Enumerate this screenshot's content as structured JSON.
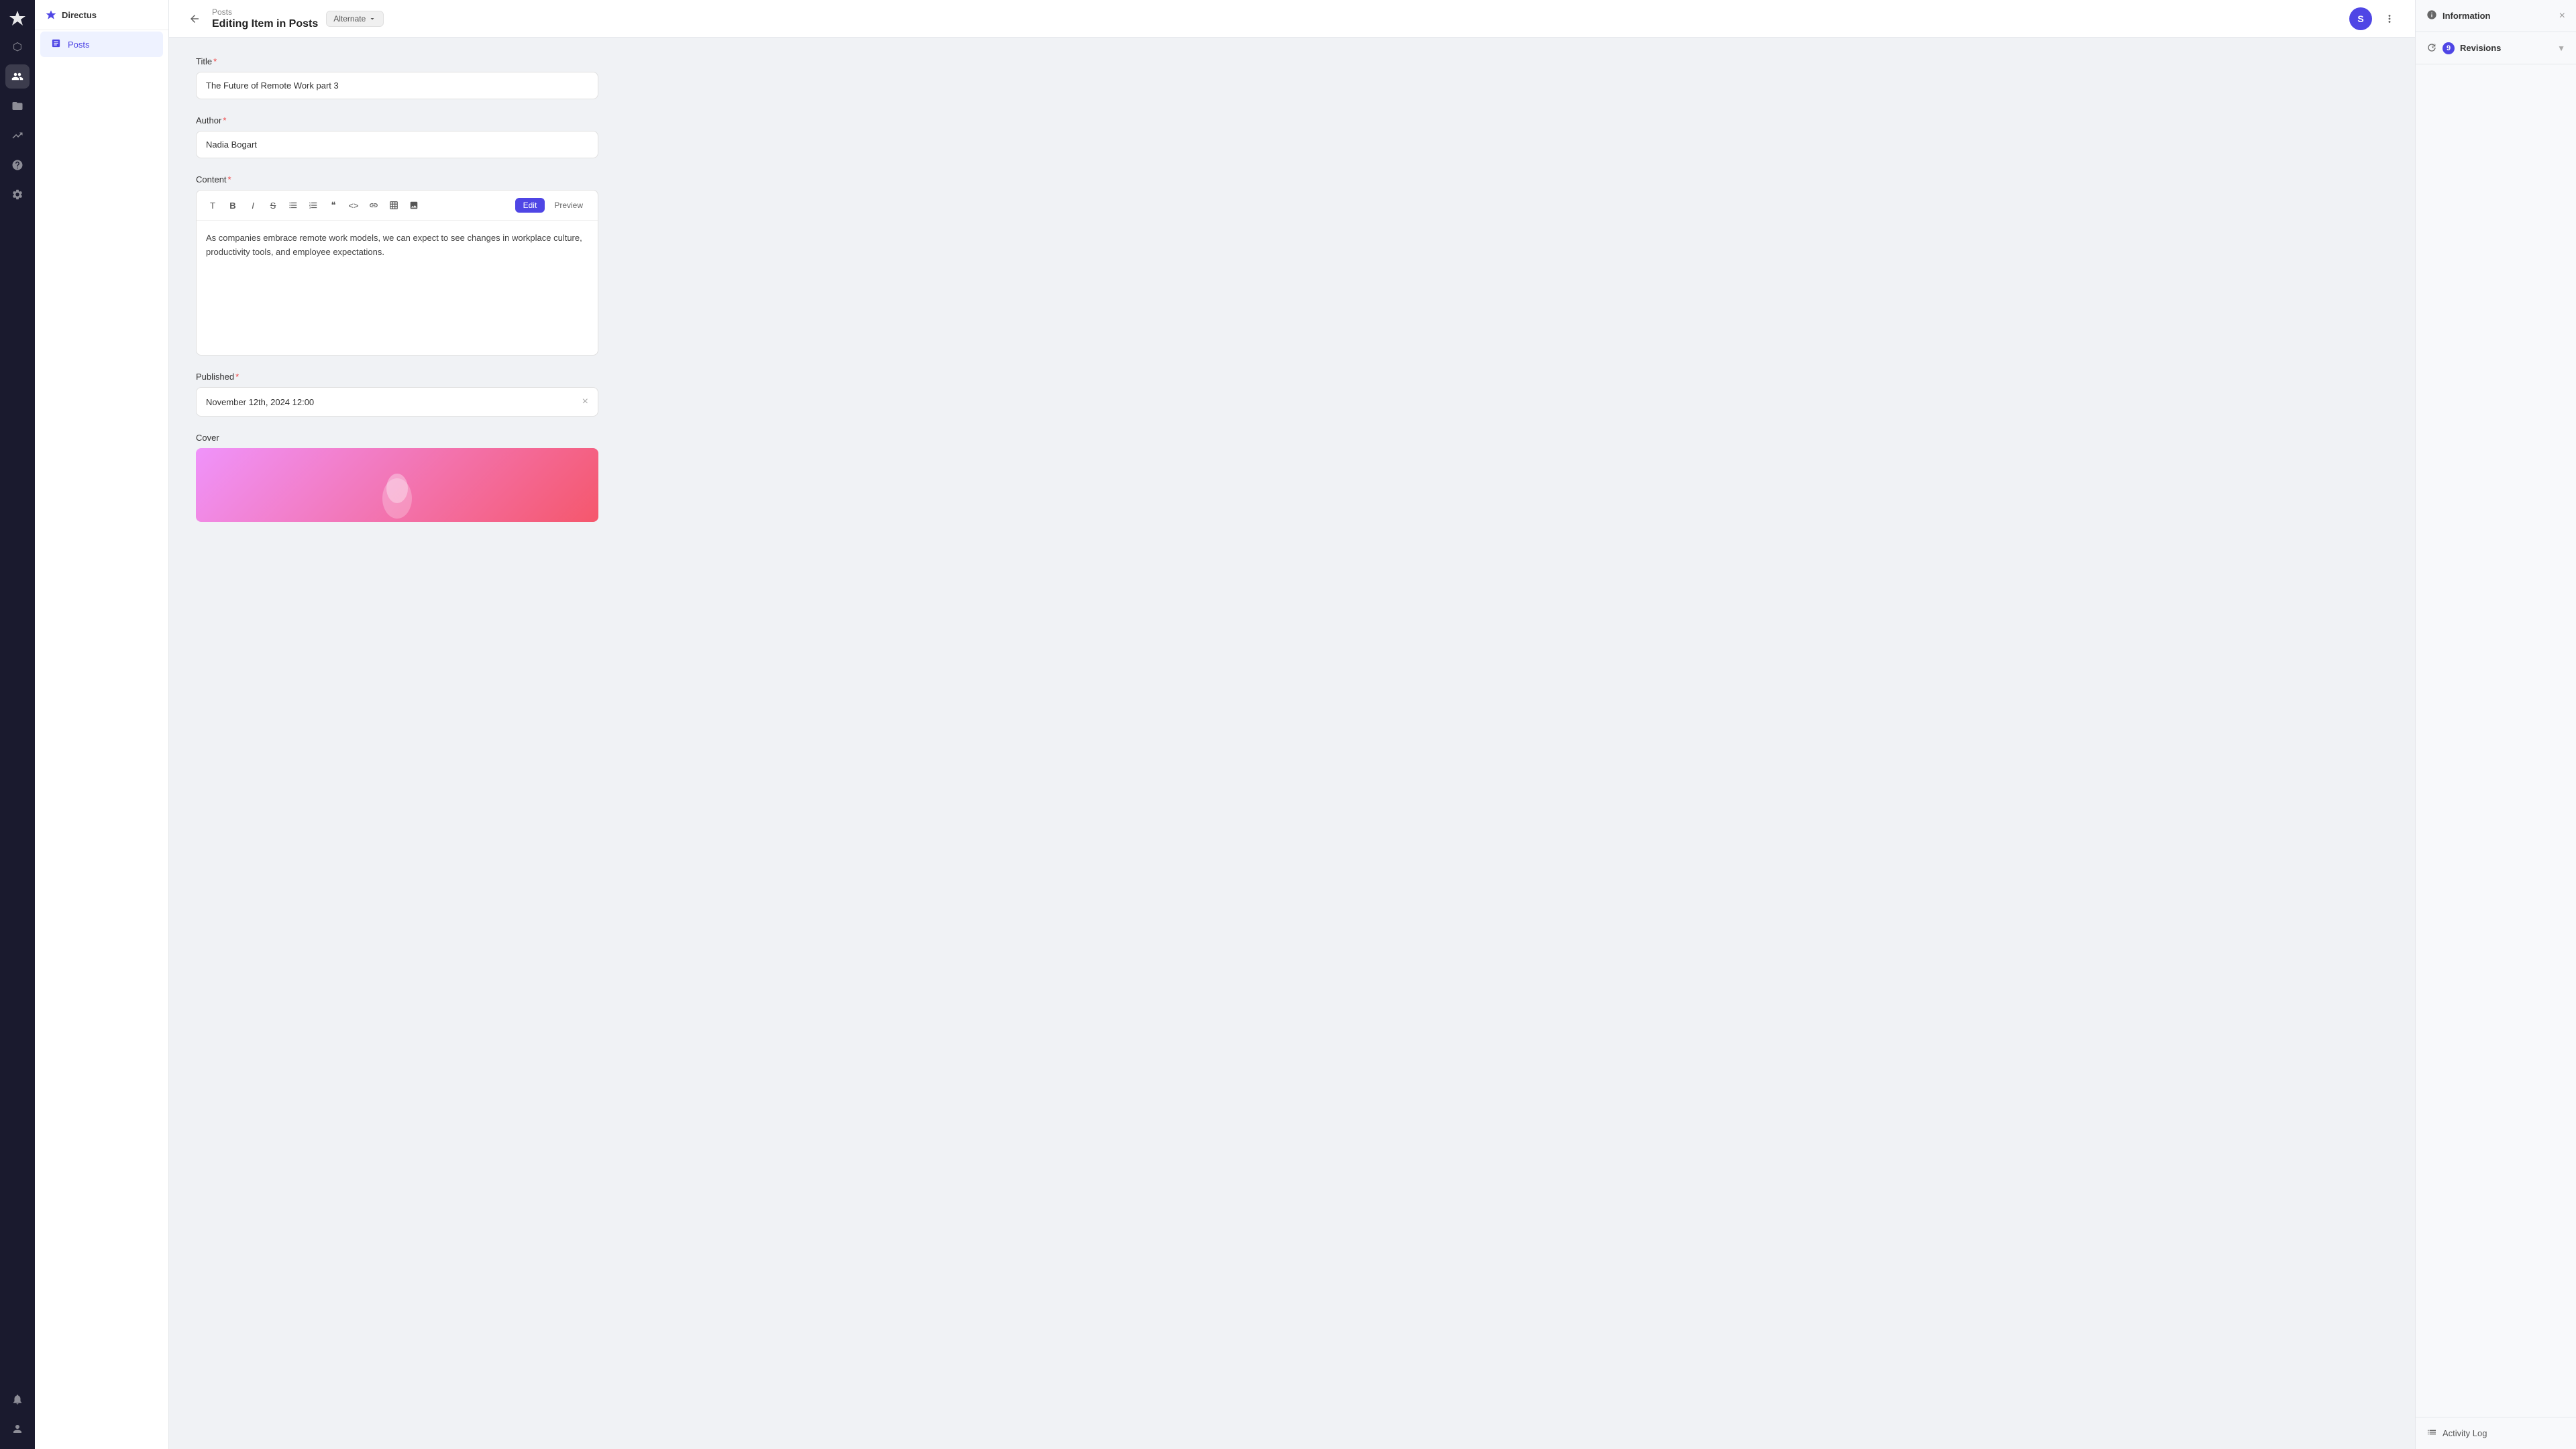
{
  "app": {
    "name": "Directus",
    "logo": "✦"
  },
  "sidebar": {
    "items": [
      {
        "icon": "⬡",
        "label": "Home",
        "active": false
      },
      {
        "icon": "👤",
        "label": "Users",
        "active": false
      },
      {
        "icon": "📁",
        "label": "Files",
        "active": false
      },
      {
        "icon": "📈",
        "label": "Insights",
        "active": false
      },
      {
        "icon": "❓",
        "label": "Help",
        "active": false
      },
      {
        "icon": "⚙",
        "label": "Settings",
        "active": false
      }
    ],
    "bottom_items": [
      {
        "icon": "🔔",
        "label": "Notifications",
        "active": false
      },
      {
        "icon": "👤",
        "label": "Profile",
        "active": false
      }
    ]
  },
  "nav_panel": {
    "title": "Directus",
    "logo": "◆",
    "items": [
      {
        "icon": "📋",
        "label": "Posts",
        "active": true
      }
    ]
  },
  "topbar": {
    "breadcrumb": "Posts",
    "title": "Editing Item in Posts",
    "variant_label": "Alternate",
    "avatar_initials": "S",
    "back_label": "←"
  },
  "form": {
    "title_label": "Title",
    "title_value": "The Future of Remote Work part 3",
    "author_label": "Author",
    "author_value": "Nadia Bogart",
    "content_label": "Content",
    "content_body": "As companies embrace remote work models, we can expect to see changes in workplace culture, productivity tools, and employee expectations.",
    "published_label": "Published",
    "published_value": "November 12th, 2024 12:00",
    "cover_label": "Cover",
    "editor_edit_btn": "Edit",
    "editor_preview_btn": "Preview"
  },
  "toolbar_icons": [
    {
      "name": "T",
      "label": "text"
    },
    {
      "name": "B",
      "label": "bold"
    },
    {
      "name": "I",
      "label": "italic"
    },
    {
      "name": "S",
      "label": "strikethrough"
    },
    {
      "name": "≡",
      "label": "unordered-list"
    },
    {
      "name": "1.",
      "label": "ordered-list"
    },
    {
      "name": "\"",
      "label": "blockquote"
    },
    {
      "name": "<>",
      "label": "code"
    },
    {
      "name": "🔗",
      "label": "link"
    },
    {
      "name": "⊞",
      "label": "table"
    },
    {
      "name": "🖼",
      "label": "image"
    }
  ],
  "right_panel": {
    "information_title": "Information",
    "close_icon": "×",
    "revisions_title": "Revisions",
    "revisions_count": "9",
    "activity_log_label": "Activity Log"
  }
}
